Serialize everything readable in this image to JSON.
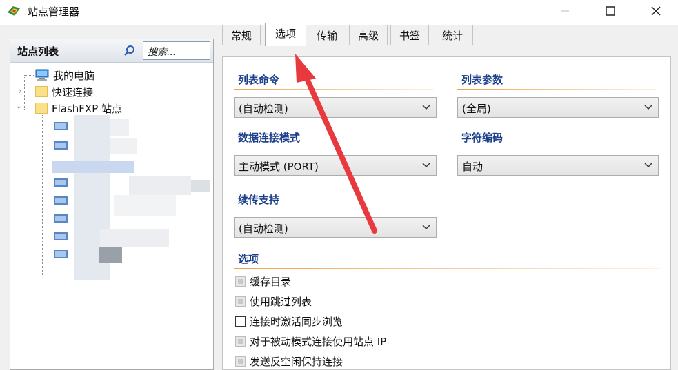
{
  "window": {
    "title": "站点管理器"
  },
  "left_panel": {
    "title": "站点列表",
    "search_placeholder": "搜索...",
    "tree": [
      {
        "label": "我的电脑",
        "icon": "computer-icon"
      },
      {
        "label": "快速连接",
        "icon": "folder-icon",
        "expander": "collapsed"
      },
      {
        "label": "FlashFXP 站点",
        "icon": "folder-icon",
        "expander": "expanded"
      }
    ],
    "obscured_site_count": 8
  },
  "tabs": [
    {
      "label": "常规",
      "active": false
    },
    {
      "label": "选项",
      "active": true
    },
    {
      "label": "传输",
      "active": false
    },
    {
      "label": "高级",
      "active": false
    },
    {
      "label": "书签",
      "active": false
    },
    {
      "label": "统计",
      "active": false
    }
  ],
  "options_tab": {
    "list_command": {
      "label": "列表命令",
      "value": "(自动检测)"
    },
    "list_params": {
      "label": "列表参数",
      "value": "(全局)"
    },
    "data_mode": {
      "label": "数据连接模式",
      "value": "主动模式 (PORT)"
    },
    "charset": {
      "label": "字符编码",
      "value": "自动"
    },
    "resume": {
      "label": "续传支持",
      "value": "(自动检测)"
    },
    "options_section": {
      "label": "选项"
    },
    "options": [
      {
        "label": "缓存目录",
        "state": "indeterminate"
      },
      {
        "label": "使用跳过列表",
        "state": "indeterminate"
      },
      {
        "label": "连接时激活同步浏览",
        "state": "unchecked"
      },
      {
        "label": "对于被动模式连接使用站点 IP",
        "state": "indeterminate"
      },
      {
        "label": "发送反空闲保持连接",
        "state": "indeterminate"
      }
    ]
  },
  "colors": {
    "section_label": "#1b3f8b",
    "section_line": "#f0a24a",
    "annotation_arrow": "#e8393f"
  }
}
